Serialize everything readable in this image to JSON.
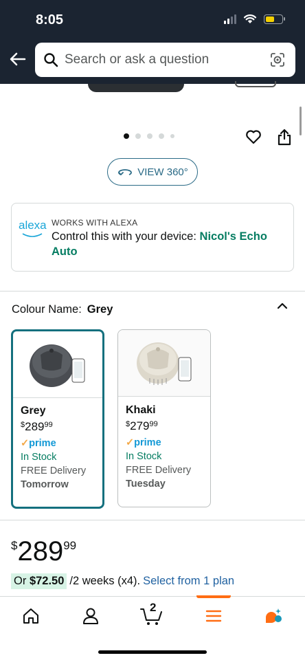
{
  "status_bar": {
    "time": "8:05"
  },
  "search": {
    "placeholder": "Search or ask a question"
  },
  "gallery": {
    "view_360_label": "VIEW 360°",
    "image_count": 5,
    "active_index": 0
  },
  "alexa": {
    "logo": "alexa",
    "overline": "WORKS WITH ALEXA",
    "text": "Control this with your device:",
    "device": "Nicol's Echo Auto"
  },
  "colour": {
    "label": "Colour Name:",
    "selected": "Grey",
    "options": [
      {
        "name": "Grey",
        "currency": "$",
        "price_whole": "289",
        "price_cents": "99",
        "prime_check": "✓",
        "prime": "prime",
        "stock": "In Stock",
        "delivery": "FREE Delivery",
        "day": "Tomorrow"
      },
      {
        "name": "Khaki",
        "currency": "$",
        "price_whole": "279",
        "price_cents": "99",
        "prime_check": "✓",
        "prime": "prime",
        "stock": "In Stock",
        "delivery": "FREE Delivery",
        "day": "Tuesday"
      }
    ]
  },
  "price": {
    "currency": "$",
    "whole": "289",
    "cents": "99"
  },
  "installment": {
    "prefix": "Or",
    "amount": "$72.50",
    "term": "/2 weeks (x4).",
    "link": "Select from 1 plan"
  },
  "nav": {
    "cart_count": "2"
  },
  "colors": {
    "header": "#1b2431",
    "selected_border": "#14707e",
    "accent_orange": "#ff6d13",
    "in_stock": "#067d62",
    "link": "#2162a1"
  },
  "icons": [
    "back-arrow-icon",
    "search-icon",
    "camera-lens-icon",
    "heart-icon",
    "share-icon",
    "rotate-360-icon",
    "chevron-up-icon",
    "home-icon",
    "account-icon",
    "cart-icon",
    "menu-icon",
    "rufus-icon"
  ]
}
